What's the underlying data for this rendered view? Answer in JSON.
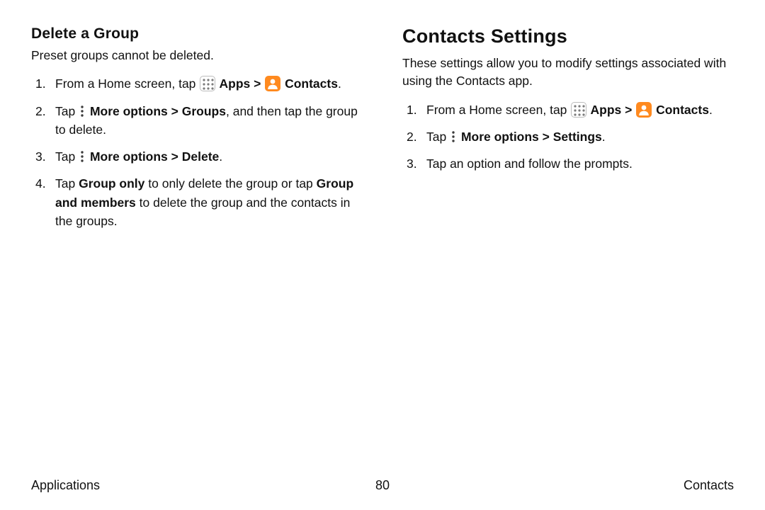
{
  "left": {
    "heading": "Delete a Group",
    "lead": "Preset groups cannot be deleted.",
    "step1_a": "From a Home screen, tap ",
    "step1_apps": " Apps",
    "step1_sep": " > ",
    "step1_contacts": " Contacts",
    "step1_end": ".",
    "step2_a": "Tap ",
    "step2_more": " More options",
    "step2_sep": " > ",
    "step2_groups": "Groups",
    "step2_b": ", and then tap the group to delete.",
    "step3_a": "Tap ",
    "step3_more": " More options",
    "step3_sep": " > ",
    "step3_delete": "Delete",
    "step3_end": ".",
    "step4_a": "Tap ",
    "step4_grouponly": "Group only",
    "step4_b": " to only delete the group or tap ",
    "step4_groupmembers": "Group and members",
    "step4_c": " to delete the group and the contacts in the groups."
  },
  "right": {
    "heading": "Contacts Settings",
    "lead": "These settings allow you to modify settings associated with using the Contacts app.",
    "step1_a": "From a Home screen, tap ",
    "step1_apps": " Apps",
    "step1_sep": " > ",
    "step1_contacts": " Contacts",
    "step1_end": ".",
    "step2_a": "Tap ",
    "step2_more": " More options",
    "step2_sep": " > ",
    "step2_settings": "Settings",
    "step2_end": ".",
    "step3": "Tap an option and follow the prompts."
  },
  "footer": {
    "left": "Applications",
    "page": "80",
    "right": "Contacts"
  }
}
